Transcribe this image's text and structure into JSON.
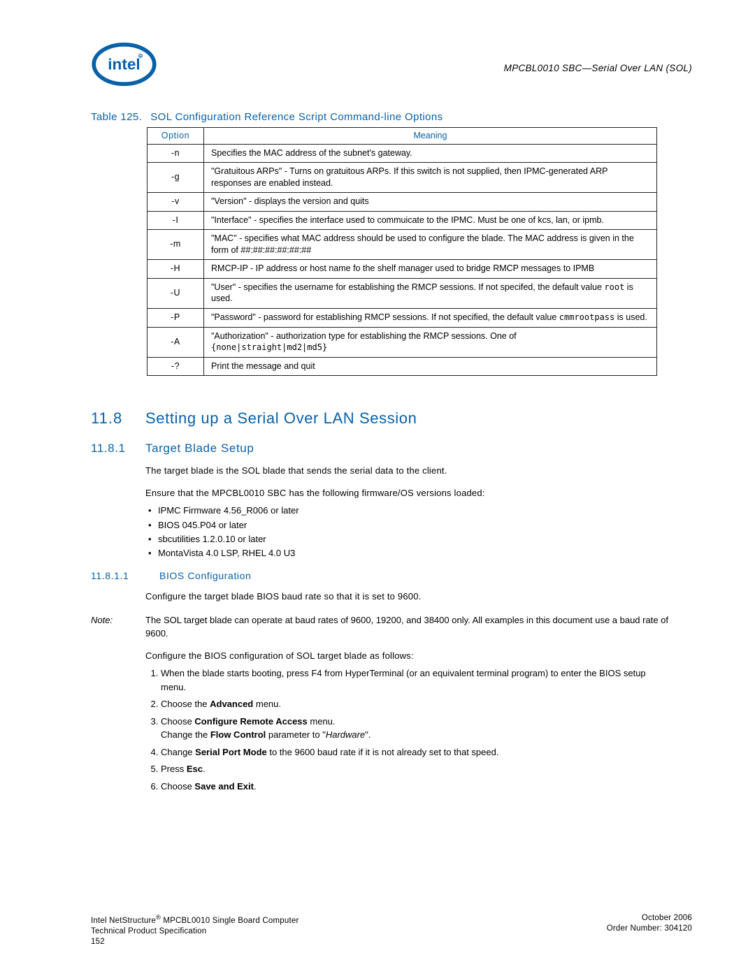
{
  "header": {
    "running_title": "MPCBL0010 SBC—Serial Over LAN (SOL)"
  },
  "table_caption": {
    "label": "Table 125.",
    "title": "SOL Configuration Reference Script Command-line Options"
  },
  "table": {
    "headers": {
      "option": "Option",
      "meaning": "Meaning"
    },
    "rows": [
      {
        "opt": "-n",
        "meaning": "Specifies the MAC address of the subnet's gateway."
      },
      {
        "opt": "-g",
        "meaning": "\"Gratuitous ARPs\" - Turns on gratuitous ARPs. If this switch is not supplied, then IPMC-generated ARP responses are enabled instead."
      },
      {
        "opt": "-v",
        "meaning": "\"Version\" - displays the version and quits"
      },
      {
        "opt": "-I",
        "meaning": "\"Interface\" - specifies the interface used to commuicate to the IPMC. Must be one of kcs, lan, or ipmb."
      },
      {
        "opt": "-m",
        "meaning": "\"MAC\" - specifies what MAC address should be used to configure the blade. The MAC address is given in the form of ##:##:##:##:##:##"
      },
      {
        "opt": "-H",
        "meaning": "RMCP-IP - IP address or host name fo the shelf manager used to bridge RMCP messages to IPMB"
      },
      {
        "opt": "-U",
        "meaning_pre": "\"User\" - specifies the username for establishing the RMCP sessions. If not specifed, the default value ",
        "meaning_code": "root",
        "meaning_post": " is used."
      },
      {
        "opt": "-P",
        "meaning_pre": "\"Password\" - password for establishing RMCP sessions. If not specified, the default value ",
        "meaning_code": "cmmrootpass",
        "meaning_post": " is used."
      },
      {
        "opt": "-A",
        "meaning_pre": "\"Authorization\" - authorization type for establishing the RMCP sessions. One of ",
        "meaning_code": "{none|straight|md2|md5}",
        "meaning_post": ""
      },
      {
        "opt": "-?",
        "meaning": "Print the message and quit"
      }
    ]
  },
  "section1": {
    "num": "11.8",
    "title": "Setting up a Serial Over LAN Session"
  },
  "section1_1": {
    "num": "11.8.1",
    "title": "Target Blade Setup",
    "p1": "The target blade is the SOL blade that sends the serial data to the client.",
    "p2": "Ensure that the MPCBL0010 SBC has the following firmware/OS versions loaded:",
    "bullets": [
      "IPMC Firmware 4.56_R006 or later",
      "BIOS 045.P04 or later",
      "sbcutilities 1.2.0.10 or later",
      "MontaVista 4.0 LSP, RHEL 4.0 U3"
    ]
  },
  "section1_1_1": {
    "num": "11.8.1.1",
    "title": "BIOS Configuration",
    "p1": "Configure the target blade BIOS baud rate so that it is set to 9600.",
    "note_label": "Note:",
    "note_body": "The SOL target blade can operate at baud rates of 9600, 19200, and 38400 only.  All examples in this document use a baud rate of 9600.",
    "p2": "Configure the BIOS configuration of SOL target blade as follows:",
    "steps": {
      "s1": "When the blade starts booting, press F4 from HyperTerminal (or an equivalent terminal program) to enter the BIOS setup menu.",
      "s2a": "Choose the ",
      "s2b": "Advanced",
      "s2c": " menu.",
      "s3a": "Choose ",
      "s3b": "Configure Remote Access",
      "s3c": " menu.",
      "s3d": "Change the ",
      "s3e": "Flow Control",
      "s3f": " parameter to \"",
      "s3g": "Hardware",
      "s3h": "\".",
      "s4a": "Change ",
      "s4b": "Serial Port Mode",
      "s4c": " to the 9600 baud rate if it is not already set to that speed.",
      "s5a": "Press ",
      "s5b": "Esc",
      "s5c": ".",
      "s6a": "Choose ",
      "s6b": "Save and Exit",
      "s6c": "."
    }
  },
  "footer": {
    "left1a": "Intel NetStructure",
    "left1b": " MPCBL0010 Single Board Computer",
    "left2": "Technical Product Specification",
    "left3": "152",
    "right1": "October 2006",
    "right2": "Order Number: 304120"
  }
}
